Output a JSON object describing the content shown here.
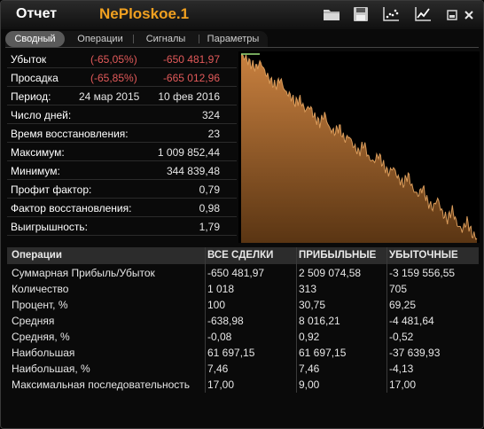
{
  "window": {
    "title": "Отчет",
    "document": "NePloskoe.1"
  },
  "tabs": [
    {
      "label": "Сводный",
      "active": true
    },
    {
      "label": "Операции",
      "active": false
    },
    {
      "label": "Сигналы",
      "active": false
    },
    {
      "label": "Параметры",
      "active": false
    }
  ],
  "summary": {
    "loss": {
      "label": "Убыток",
      "pct": "(-65,05%)",
      "value": "-650 481,97"
    },
    "drawdown": {
      "label": "Просадка",
      "pct": "(-65,85%)",
      "value": "-665 012,96"
    },
    "period": {
      "label": "Период:",
      "from": "24 мар 2015",
      "to": "10 фев 2016"
    },
    "days": {
      "label": "Число дней:",
      "value": "324"
    },
    "recovery_time": {
      "label": "Время восстановления:",
      "value": "23"
    },
    "maximum": {
      "label": "Максимум:",
      "value": "1 009 852,44"
    },
    "minimum": {
      "label": "Минимум:",
      "value": "344 839,48"
    },
    "profit_factor": {
      "label": "Профит фактор:",
      "value": "0,79"
    },
    "recovery_factor": {
      "label": "Фактор восстановления:",
      "value": "0,98"
    },
    "payoff": {
      "label": "Выигрышность:",
      "value": "1,79"
    }
  },
  "table": {
    "headers": [
      "Операции",
      "ВСЕ СДЕЛКИ",
      "ПРИБЫЛЬНЫЕ",
      "УБЫТОЧНЫЕ"
    ],
    "rows": [
      [
        "Суммарная Прибыль/Убыток",
        "-650 481,97",
        "2 509 074,58",
        "-3 159 556,55"
      ],
      [
        "Количество",
        "1 018",
        "313",
        "705"
      ],
      [
        "Процент, %",
        "100",
        "30,75",
        "69,25"
      ],
      [
        "Средняя",
        "-638,98",
        "8 016,21",
        "-4 481,64"
      ],
      [
        "Средняя, %",
        "-0,08",
        "0,92",
        "-0,52"
      ],
      [
        "Наибольшая",
        "61 697,15",
        "61 697,15",
        "-37 639,93"
      ],
      [
        "Наибольшая, %",
        "7,46",
        "7,46",
        "-4,13"
      ],
      [
        "Максимальная последовательность",
        "17,00",
        "9,00",
        "17,00"
      ]
    ]
  },
  "colors": {
    "accent": "#f0a020",
    "negative": "#e35a5a",
    "chart_fill_top": "#c8803f",
    "chart_fill_bottom": "#5a3513"
  },
  "icons": [
    "folder-icon",
    "save-icon",
    "scatter-chart-icon",
    "line-chart-icon",
    "minimize-icon",
    "close-icon"
  ],
  "chart_data": {
    "type": "area",
    "x": [
      "24 мар 2015",
      "10 фев 2016"
    ],
    "y_relative": [
      1.0,
      0.98,
      0.95,
      0.93,
      0.96,
      0.9,
      0.86,
      0.83,
      0.87,
      0.8,
      0.78,
      0.74,
      0.76,
      0.7,
      0.72,
      0.66,
      0.63,
      0.68,
      0.6,
      0.58,
      0.61,
      0.54,
      0.56,
      0.5,
      0.47,
      0.52,
      0.44,
      0.42,
      0.46,
      0.4,
      0.36,
      0.39,
      0.33,
      0.3,
      0.35,
      0.27,
      0.24,
      0.28,
      0.2,
      0.17,
      0.22,
      0.14,
      0.11,
      0.16,
      0.08,
      0.05,
      0.1,
      0.03,
      0.0
    ],
    "title": "",
    "xlabel": "",
    "ylabel": ""
  }
}
